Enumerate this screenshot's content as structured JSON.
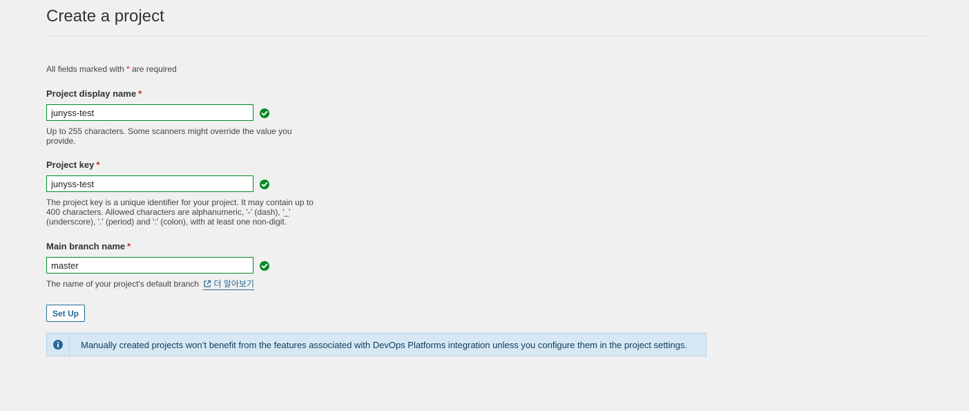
{
  "page": {
    "title": "Create a project",
    "required_note_prefix": "All fields marked with ",
    "required_note_asterisk": "*",
    "required_note_suffix": " are required"
  },
  "fields": {
    "display_name": {
      "label": "Project display name",
      "asterisk": "*",
      "value": "junyss-test",
      "help": "Up to 255 characters. Some scanners might override the value you provide.",
      "status_icon": "check-circle-icon",
      "status_color": "#008a25"
    },
    "project_key": {
      "label": "Project key",
      "asterisk": "*",
      "value": "junyss-test",
      "help": "The project key is a unique identifier for your project. It may contain up to 400 characters. Allowed characters are alphanumeric, '-' (dash), '_' (underscore), '.' (period) and ':' (colon), with at least one non-digit.",
      "status_icon": "check-circle-icon",
      "status_color": "#008a25"
    },
    "main_branch": {
      "label": "Main branch name",
      "asterisk": "*",
      "value": "master",
      "help": "The name of your project's default branch",
      "link_label": "더 알아보기",
      "link_icon": "external-link-icon",
      "status_icon": "check-circle-icon",
      "status_color": "#008a25"
    }
  },
  "actions": {
    "setup_label": "Set Up"
  },
  "info": {
    "icon": "info-icon",
    "message": "Manually created projects won’t benefit from the features associated with DevOps Platforms integration unless you configure them in the project settings."
  },
  "colors": {
    "accent": "#236a97",
    "valid": "#008a25",
    "required": "#c62828",
    "info_bg": "#d7e8f4"
  }
}
